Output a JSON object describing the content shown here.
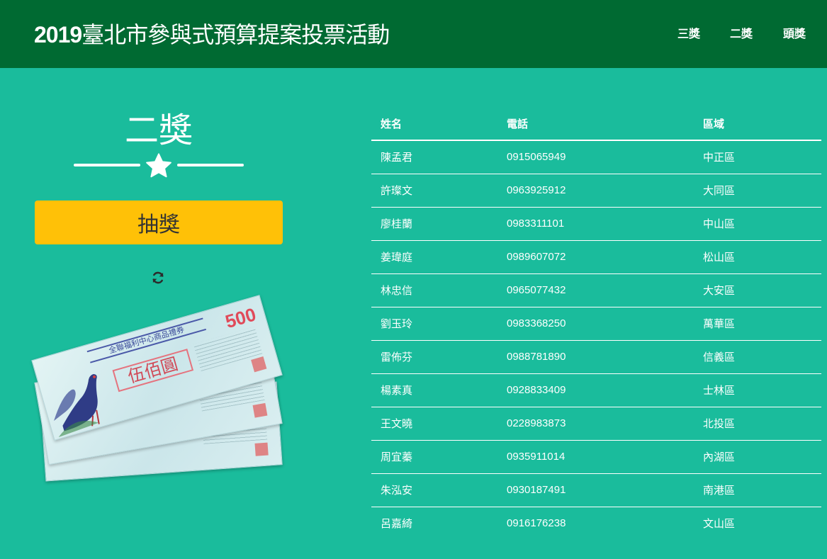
{
  "header": {
    "brand_year": "2019",
    "brand_title": "臺北市參與式預算提案投票活動",
    "nav": [
      "三獎",
      "二獎",
      "頭獎"
    ],
    "bg_color": "#006a32"
  },
  "prize": {
    "title": "二獎",
    "divider_icon": "star-icon",
    "draw_label": "抽獎",
    "refresh_icon": "refresh-icon"
  },
  "vouchers": {
    "issuer": "全聯福利中心商品禮券",
    "face": "伍佰圓",
    "value": "500",
    "count": 3
  },
  "winners": {
    "headers": [
      "姓名",
      "電話",
      "區域"
    ],
    "rows": [
      [
        "陳孟君",
        "0915065949",
        "中正區"
      ],
      [
        "許璨文",
        "0963925912",
        "大同區"
      ],
      [
        "廖桂蘭",
        "0983311101",
        "中山區"
      ],
      [
        "姜瑋庭",
        "0989607072",
        "松山區"
      ],
      [
        "林忠信",
        "0965077432",
        "大安區"
      ],
      [
        "劉玉玲",
        "0983368250",
        "萬華區"
      ],
      [
        "雷佈芬",
        "0988781890",
        "信義區"
      ],
      [
        "楊素真",
        "0928833409",
        "士林區"
      ],
      [
        "王文曉",
        "0228983873",
        "北投區"
      ],
      [
        "周宜蓁",
        "0935911014",
        "內湖區"
      ],
      [
        "朱泓安",
        "0930187491",
        "南港區"
      ],
      [
        "呂嘉綺",
        "0916176238",
        "文山區"
      ]
    ]
  },
  "colors": {
    "page_bg": "#1abc9c",
    "button_bg": "#ffc107"
  }
}
